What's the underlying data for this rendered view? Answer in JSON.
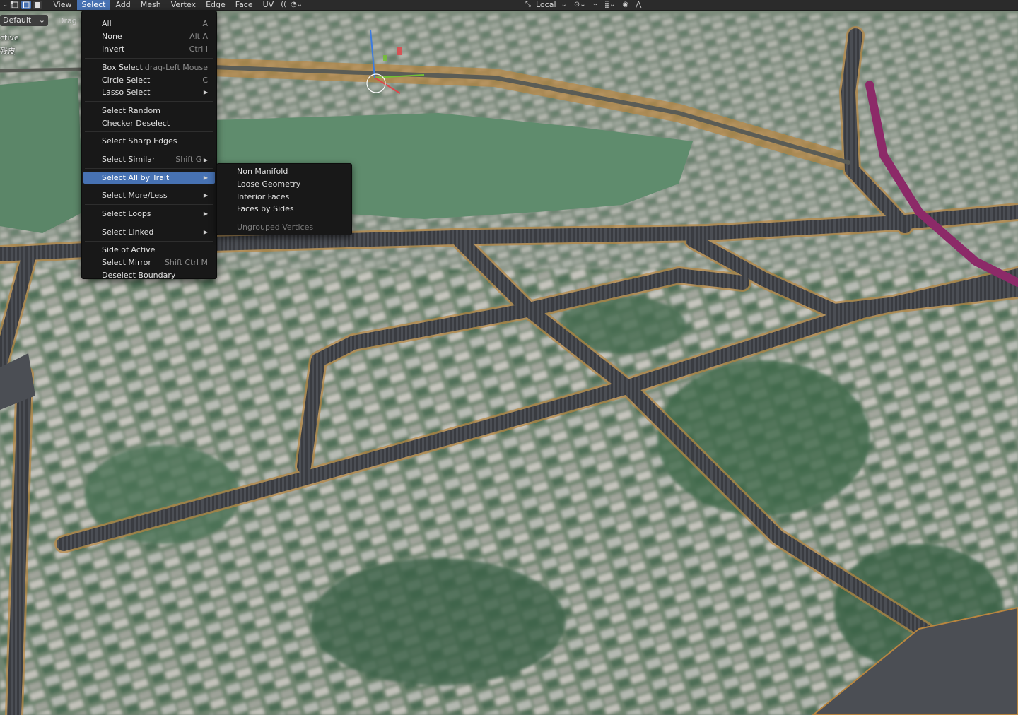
{
  "header": {
    "menus": [
      "View",
      "Select",
      "Add",
      "Mesh",
      "Vertex",
      "Edge",
      "Face",
      "UV"
    ],
    "active_menu": "Select",
    "transform_orientation": "Local",
    "icons": [
      "chevron-down-icon",
      "vertex-select-icon",
      "edge-select-icon",
      "face-select-icon",
      "xray-icon",
      "proportional-edit-icon",
      "snap-icon",
      "pivot-icon"
    ]
  },
  "toolbar": {
    "orientation_value": "Default",
    "drag_label": "Drag:"
  },
  "overlay": {
    "line1": "ctive",
    "line2": "残皮"
  },
  "select_menu": {
    "items": [
      {
        "label": "All",
        "shortcut": "A"
      },
      {
        "label": "None",
        "shortcut": "Alt A"
      },
      {
        "label": "Invert",
        "shortcut": "Ctrl I"
      },
      {
        "label": "Box Select",
        "shortcut": "drag-Left Mouse"
      },
      {
        "label": "Circle Select",
        "shortcut": "C"
      },
      {
        "label": "Lasso Select",
        "shortcut": ""
      },
      {
        "label": "Select Random",
        "shortcut": ""
      },
      {
        "label": "Checker Deselect",
        "shortcut": ""
      },
      {
        "label": "Select Sharp Edges",
        "shortcut": ""
      },
      {
        "label": "Select Similar",
        "shortcut": "Shift G"
      },
      {
        "label": "Select All by Trait",
        "shortcut": ""
      },
      {
        "label": "Select More/Less",
        "shortcut": ""
      },
      {
        "label": "Select Loops",
        "shortcut": ""
      },
      {
        "label": "Select Linked",
        "shortcut": ""
      },
      {
        "label": "Side of Active",
        "shortcut": ""
      },
      {
        "label": "Select Mirror",
        "shortcut": "Shift Ctrl M"
      },
      {
        "label": "Deselect Boundary",
        "shortcut": ""
      }
    ],
    "highlighted": "Select All by Trait"
  },
  "trait_menu": {
    "items": [
      {
        "label": "Non Manifold"
      },
      {
        "label": "Loose Geometry"
      },
      {
        "label": "Interior Faces"
      },
      {
        "label": "Faces by Sides"
      },
      {
        "label": "Ungrouped Vertices"
      }
    ],
    "disabled": "Ungrouped Vertices"
  },
  "colors": {
    "menu_bg": "#181818",
    "highlight": "#4772b3",
    "header_bg": "#2b2b2b",
    "road": "#4a4d52",
    "road_edge": "#c08a3a",
    "magenta_road": "#8c2a68",
    "lake": "#5e8a6c"
  }
}
